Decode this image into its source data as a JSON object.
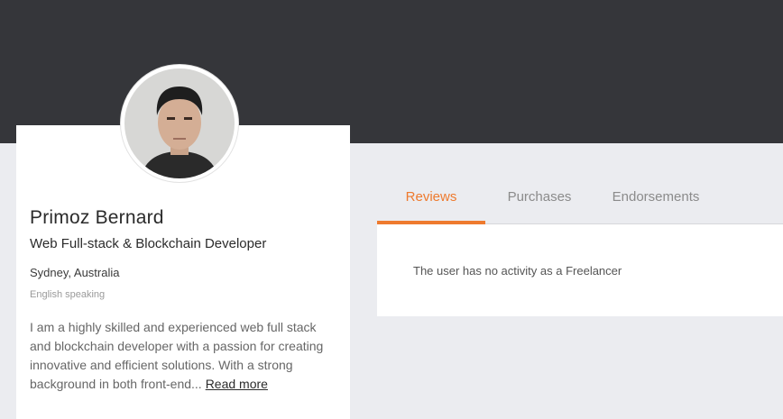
{
  "profile": {
    "name": "Primoz Bernard",
    "headline": "Web Full-stack & Blockchain Developer",
    "location": "Sydney, Australia",
    "language": "English speaking",
    "bio": "I am a highly skilled and experienced web full stack and blockchain developer with a passion for creating innovative and efficient solutions. With a strong background in both front-end...",
    "read_more_label": "Read more"
  },
  "tabs": [
    {
      "label": "Reviews",
      "active": true
    },
    {
      "label": "Purchases",
      "active": false
    },
    {
      "label": "Endorsements",
      "active": false
    }
  ],
  "panel": {
    "empty_message": "The user has no activity as a Freelancer"
  },
  "colors": {
    "banner": "#35363a",
    "accent": "#ee7a2e",
    "page_bg": "#ebecf0"
  }
}
